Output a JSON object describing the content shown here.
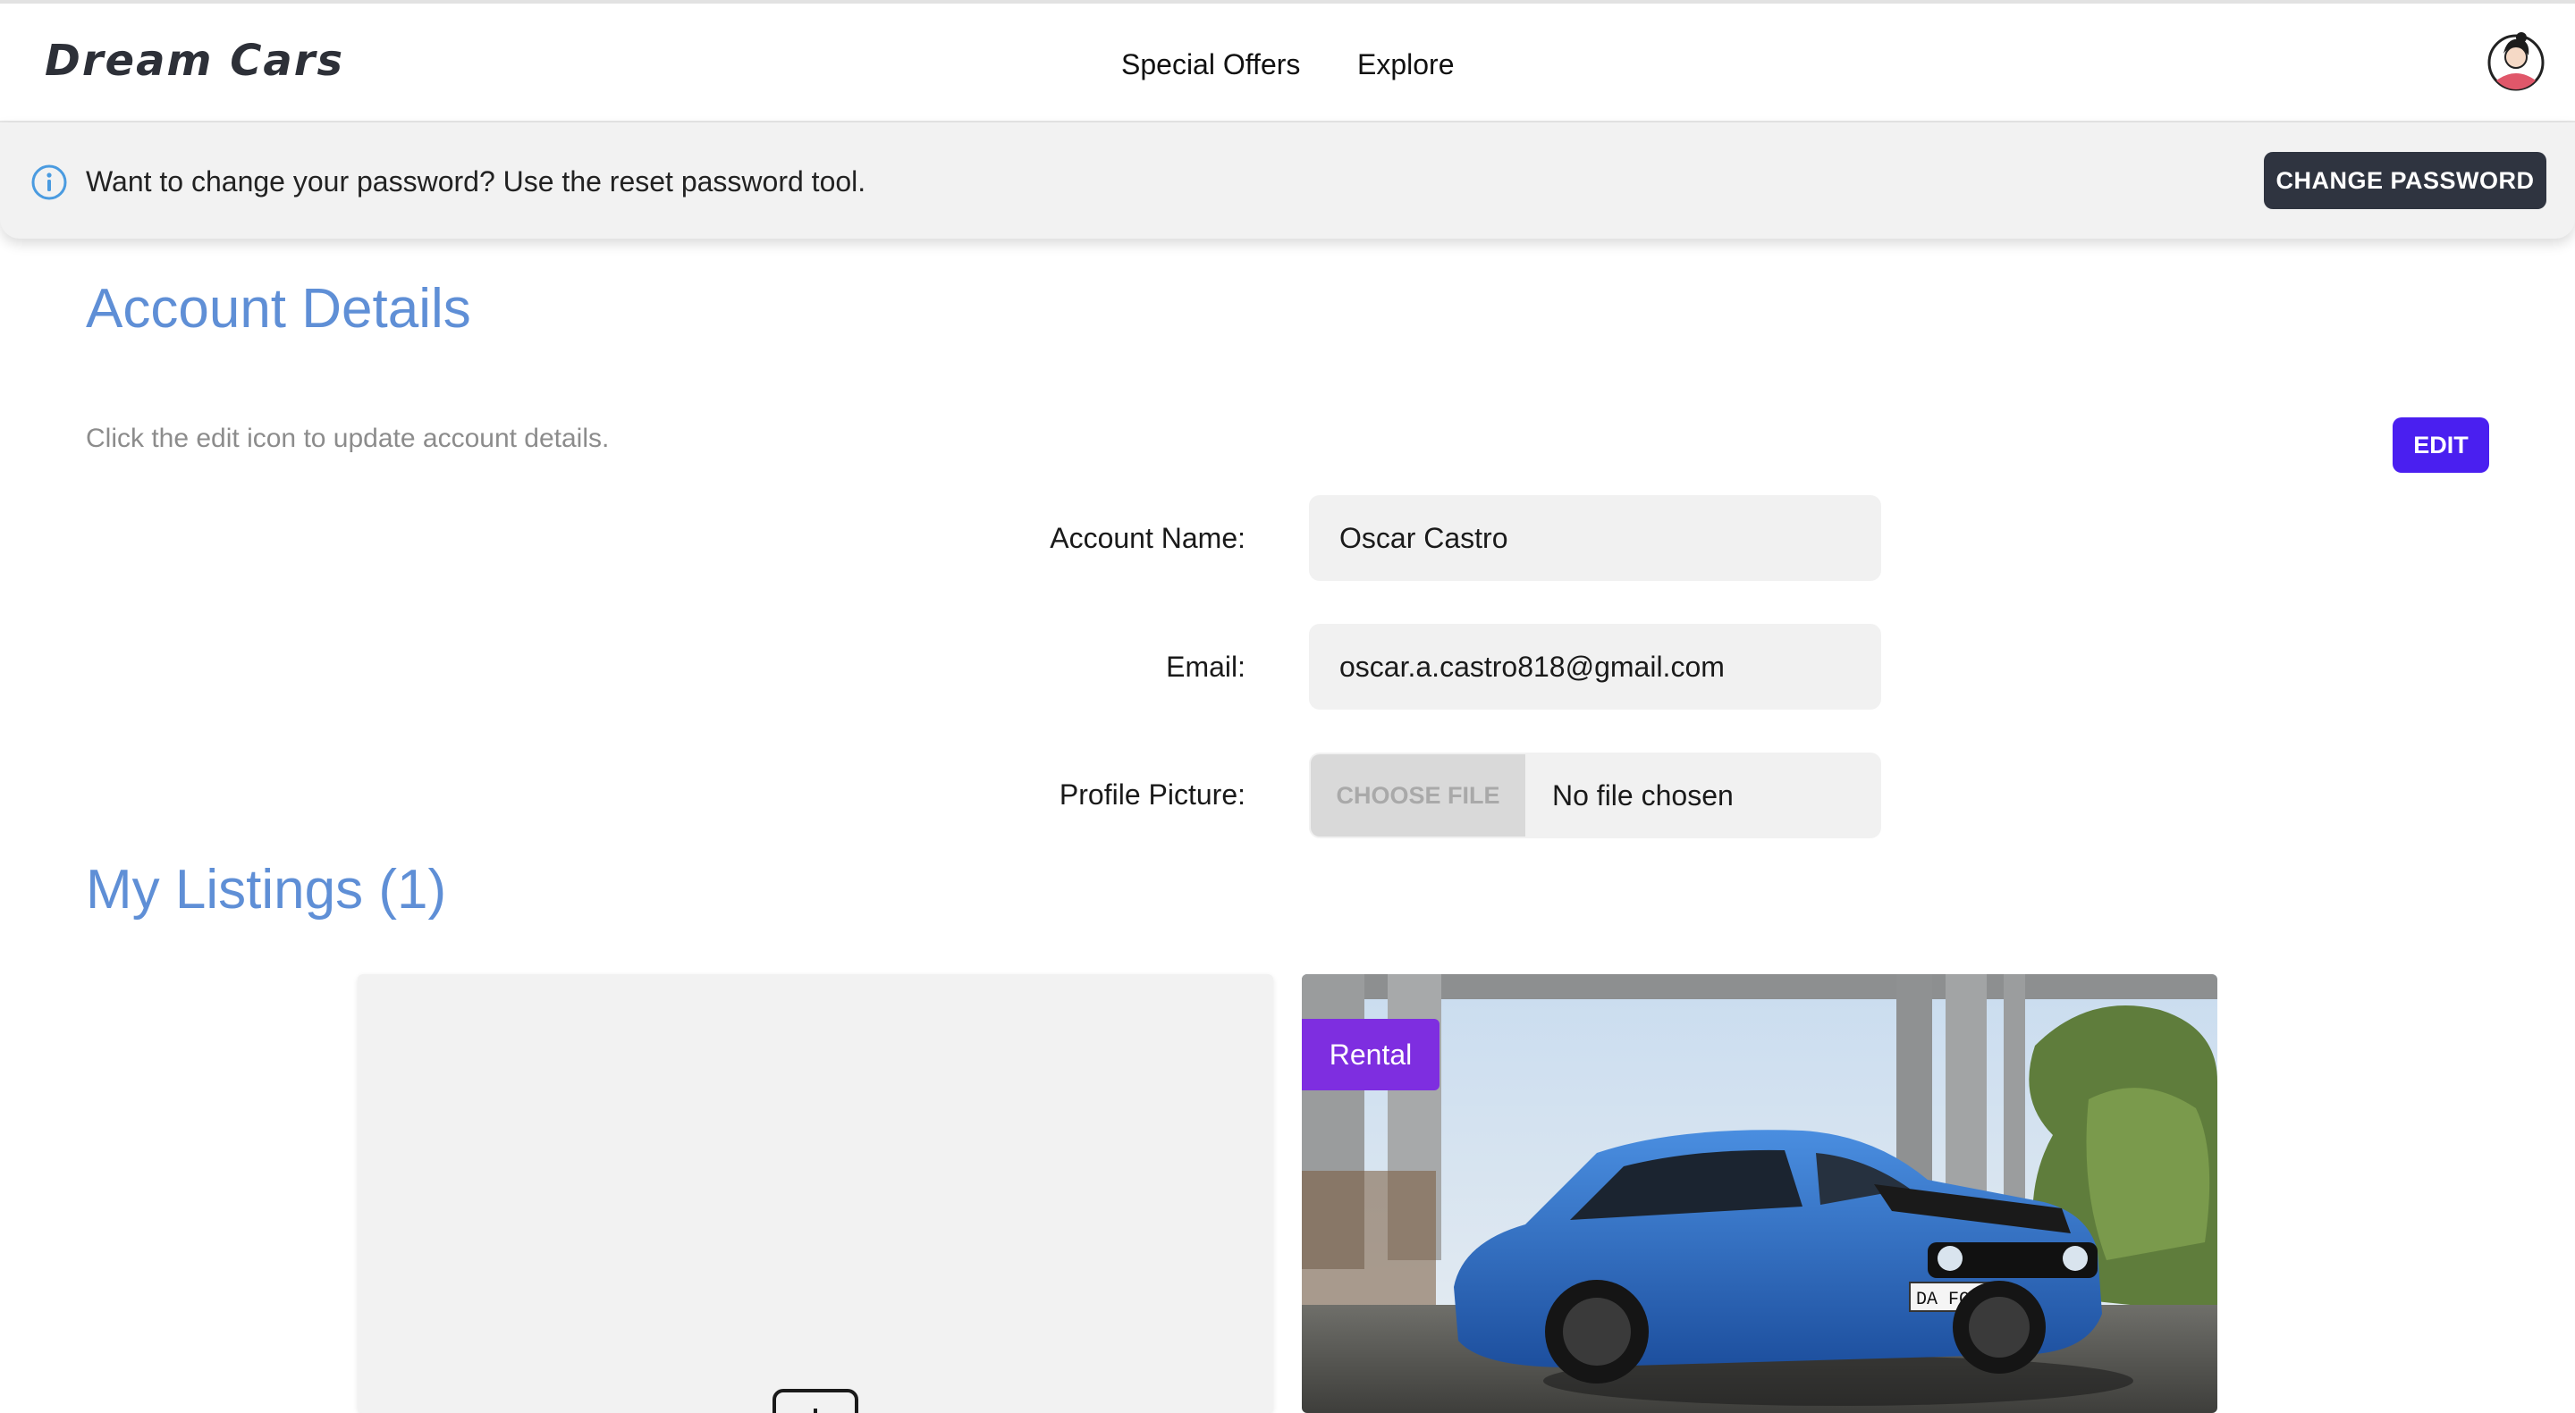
{
  "navbar": {
    "brand": "Dream Cars",
    "links": [
      "Special Offers",
      "Explore"
    ],
    "avatar_icon": "user-avatar"
  },
  "alert": {
    "icon": "info-icon",
    "message": "Want to change your password? Use the reset password tool.",
    "button_label": "CHANGE PASSWORD"
  },
  "account": {
    "title": "Account Details",
    "helper": "Click the edit icon to update account details.",
    "edit_label": "EDIT",
    "fields": {
      "name_label": "Account Name:",
      "name_value": "Oscar Castro",
      "email_label": "Email:",
      "email_value": "oscar.a.castro818@gmail.com",
      "picture_label": "Profile Picture:",
      "file_button": "CHOOSE FILE",
      "file_status": "No file chosen"
    }
  },
  "listings": {
    "title": "My Listings (1)",
    "add_icon": "plus-icon",
    "items": [
      {
        "badge": "Rental",
        "plate": "DA FC492"
      }
    ]
  },
  "colors": {
    "accent_blue": "#5f8fd6",
    "edit_purple": "#4a1ff0",
    "badge_purple": "#7e2ee0",
    "dark_button": "#2f3440"
  }
}
